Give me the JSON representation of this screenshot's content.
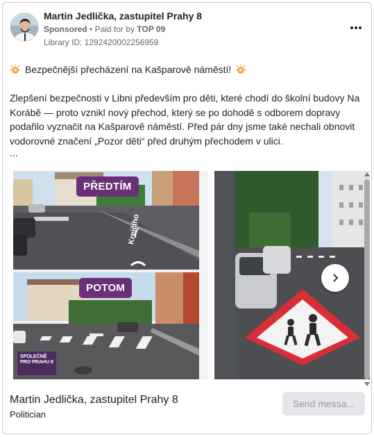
{
  "post": {
    "page_name": "Martin Jedlička, zastupitel Prahy 8",
    "sponsored_label": "Sponsored",
    "separator": "•",
    "paid_for_by": "Paid for by",
    "payer": "TOP 09",
    "library_id": "Library ID: 1292420002256959",
    "headline": "Bezpečnější přecházení na Kašparově náměstí!",
    "body": "Zlepšení bezpečnosti v Libni především pro děti, které chodí do školní budovy Na Korábě — proto vznikl nový přechod, který se po dohodě s odborem dopravy podařilo vyznačit na Kašparově náměstí. Před pár dny jsme také nechali obnovit vodorovné značení „Pozor děti“ před druhým přechodem v ulici.",
    "ellipsis": "...",
    "icons": {
      "menu": "more-horizontal-icon",
      "warning": "warning-light-icon",
      "next": "chevron-right-icon"
    }
  },
  "carousel": {
    "slide1": {
      "before_label": "PŘEDTÍM",
      "after_label": "POTOM",
      "street_label": "Krejčího",
      "logo_lines": [
        "SPOLEČNĚ",
        "PRO PRAHU 8"
      ]
    }
  },
  "footer": {
    "name": "Martin Jedlička, zastupitel Prahy 8",
    "category": "Politician",
    "send_button": "Send messa..."
  },
  "colors": {
    "tag_purple": "#6a2f76",
    "crossing_red": "#d92e35",
    "text": "#1c1e21",
    "muted": "#65676b"
  }
}
